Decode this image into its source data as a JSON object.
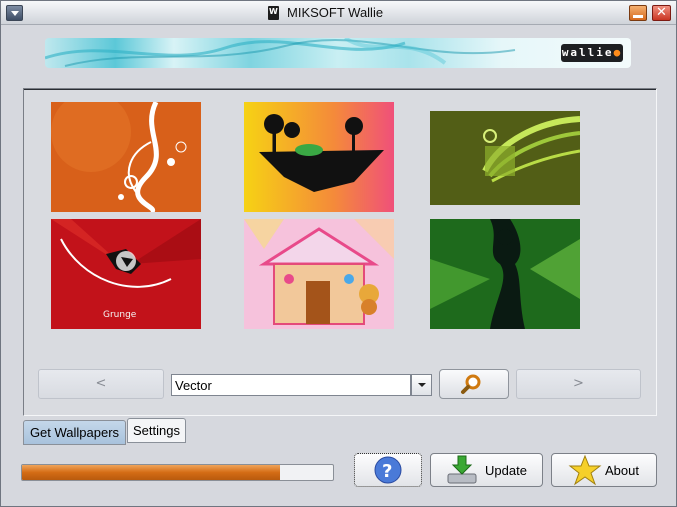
{
  "window": {
    "title": "MIKSOFT Wallie"
  },
  "banner": {
    "logo_text": "wallie"
  },
  "gallery": {
    "thumbnails": [
      {
        "name": "orange-swirl-wallpaper",
        "colors": [
          "#d45a12",
          "#f08a2a"
        ]
      },
      {
        "name": "floating-island-wallpaper",
        "colors": [
          "#f4d21a",
          "#f06a8a"
        ]
      },
      {
        "name": "green-abstract-wallpaper",
        "colors": [
          "#4d5a14",
          "#8aa030"
        ]
      },
      {
        "name": "red-grunge-wallpaper",
        "colors": [
          "#b50c14",
          "#e02a2a"
        ]
      },
      {
        "name": "gingerbread-house-wallpaper",
        "colors": [
          "#f4b6d6",
          "#f7d26a"
        ]
      },
      {
        "name": "green-silhouette-wallpaper",
        "colors": [
          "#1d6a1a",
          "#5bb83a"
        ]
      }
    ]
  },
  "navigation": {
    "prev_label": "<",
    "next_label": ">"
  },
  "search": {
    "category_value": "Vector"
  },
  "tabs": [
    {
      "label": "Get Wallpapers",
      "active": true
    },
    {
      "label": "Settings",
      "active": false
    }
  ],
  "progress": {
    "fraction": 0.83
  },
  "buttons": {
    "help_icon": "question-mark-icon",
    "update_label": "Update",
    "about_label": "About"
  },
  "colors": {
    "accent": "#d46c15",
    "active_tab": "#a8c2dc"
  }
}
